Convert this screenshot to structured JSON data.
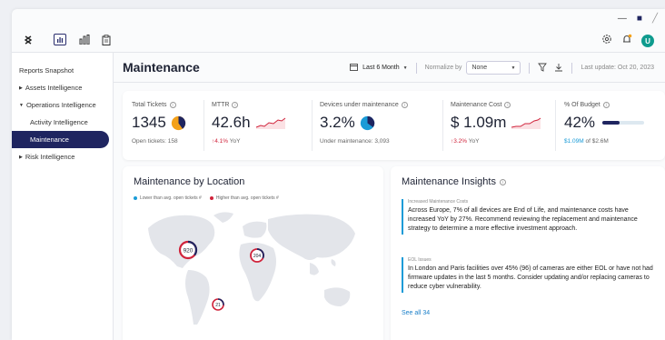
{
  "window_controls": {
    "minimize": "—",
    "maximize": "■",
    "close": "╱"
  },
  "topbar": {
    "user_initial": "U"
  },
  "sidebar": {
    "items": [
      {
        "label": "Reports Snapshot"
      },
      {
        "label": "Assets Intelligence"
      },
      {
        "label": "Operations Intelligence"
      },
      {
        "label": "Activity Intelligence"
      },
      {
        "label": "Maintenance"
      },
      {
        "label": "Risk Intelligence"
      }
    ]
  },
  "header": {
    "title": "Maintenance",
    "date_range": "Last 6 Month",
    "normalize_label": "Normalize by",
    "normalize_value": "None",
    "last_update": "Last update: Oct 20, 2023"
  },
  "kpis": {
    "total_tickets": {
      "label": "Total Tickets",
      "value": "1345",
      "sub": "Open tickets: 158",
      "pie_fraction": 0.4
    },
    "mttr": {
      "label": "MTTR",
      "value": "42.6h",
      "change": "4.1%",
      "change_suffix": "YoY"
    },
    "devices": {
      "label": "Devices under maintenance",
      "value": "3.2%",
      "sub": "Under maintenance: 3,093",
      "pie_fraction": 0.35
    },
    "cost": {
      "label": "Maintenance Cost",
      "value": "$ 1.09m",
      "change": "3.2%",
      "change_suffix": "YoY"
    },
    "budget": {
      "label": "% Of Budget",
      "value": "42%",
      "spent": "$1.09M",
      "total_prefix": "of",
      "total": "$2.6M",
      "fraction": 0.42
    }
  },
  "location": {
    "title": "Maintenance by Location",
    "legend_lower": "Lower than avg. open tickets #",
    "legend_higher": "Higher than avg. open tickets #",
    "markers": [
      {
        "label": "920"
      },
      {
        "label": "204"
      },
      {
        "label": "21"
      }
    ]
  },
  "insights": {
    "title": "Maintenance Insights",
    "items": [
      {
        "tag": "Increased Maintenance Costs",
        "text": "Across Europe, 7% of all devices are End of Life, and maintenance costs have increased YoY by 27%. Recommend reviewing the replacement and maintenance strategy to determine a more effective investment approach."
      },
      {
        "tag": "EOL Issues",
        "text": "In London and Paris facilities over 45% (96) of cameras are either EOL or have not had firmware updates in the last 5 months. Consider updating and/or replacing cameras to reduce cyber vulnerability."
      }
    ],
    "see_all": "See all 34"
  },
  "colors": {
    "navy": "#1f2560",
    "orange": "#f4a11a",
    "blue": "#1a9bd7",
    "red": "#d0233b",
    "teal": "#0f9b8e"
  }
}
